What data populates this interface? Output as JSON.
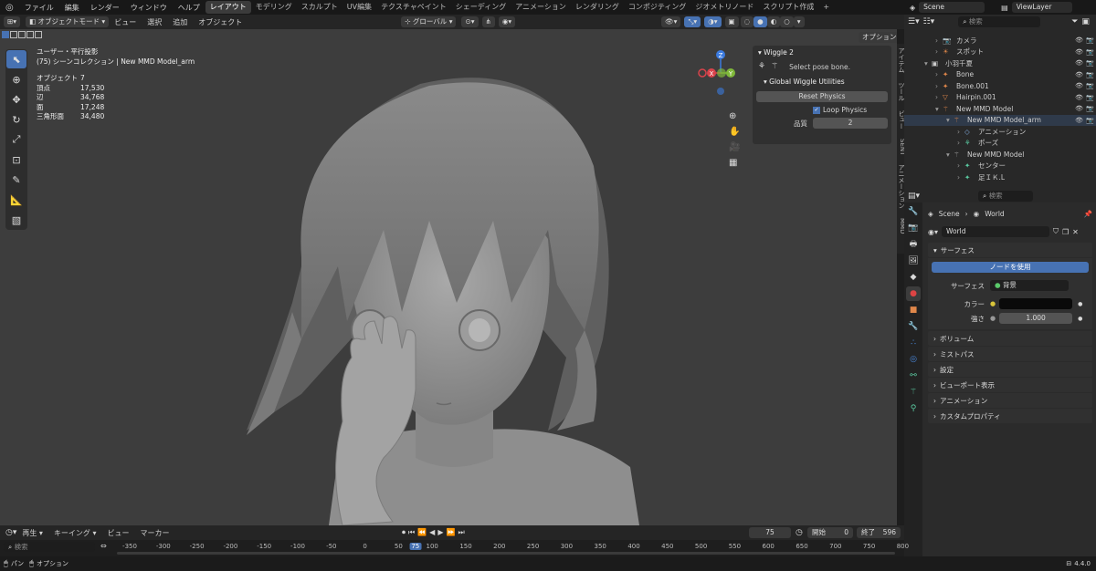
{
  "top_menu": [
    "ファイル",
    "編集",
    "レンダー",
    "ウィンドウ",
    "ヘルプ"
  ],
  "workspaces": [
    "レイアウト",
    "モデリング",
    "スカルプト",
    "UV編集",
    "テクスチャペイント",
    "シェーディング",
    "アニメーション",
    "レンダリング",
    "コンポジティング",
    "ジオメトリノード",
    "スクリプト作成"
  ],
  "active_workspace": "レイアウト",
  "add_tab": "+",
  "scene_name": "Scene",
  "view_layer": "ViewLayer",
  "viewport_header": {
    "mode": "オブジェクトモード",
    "menus": [
      "ビュー",
      "選択",
      "追加",
      "オブジェクト"
    ],
    "transform": "グローバル",
    "options": "オプション"
  },
  "viewport_info": {
    "view": "ユーザー・平行投影",
    "collection": "(75) シーンコレクション | New MMD Model_arm",
    "stats": [
      {
        "label": "オブジェクト",
        "value": "7"
      },
      {
        "label": "頂点",
        "value": "17,530"
      },
      {
        "label": "辺",
        "value": "34,768"
      },
      {
        "label": "面",
        "value": "17,248"
      },
      {
        "label": "三角形面",
        "value": "34,480"
      }
    ]
  },
  "gizmo": {
    "z": "Z",
    "y": "Y",
    "x": "X"
  },
  "side_tabs": [
    "アイテム",
    "ツール",
    "ビュー",
    "SENT",
    "アニメーション",
    "MMD"
  ],
  "wiggle_panel": {
    "title": "Wiggle 2",
    "hint": "Select pose bone.",
    "utilities": "Global Wiggle Utilities",
    "reset": "Reset Physics",
    "loop": "Loop Physics",
    "quality_label": "品質",
    "quality_value": "2"
  },
  "outliner": {
    "search_placeholder": "検索",
    "rows": [
      {
        "label": "カメラ",
        "indent": 1,
        "icon": "camera-icon",
        "color": "#e0874a"
      },
      {
        "label": "スポット",
        "indent": 1,
        "icon": "light-icon",
        "color": "#e0874a"
      },
      {
        "label": "小羽千夏",
        "indent": 0,
        "icon": "collection-icon",
        "color": "#ccc"
      },
      {
        "label": "Bone",
        "indent": 1,
        "icon": "bone-icon",
        "color": "#e0874a"
      },
      {
        "label": "Bone.001",
        "indent": 1,
        "icon": "bone-icon",
        "color": "#e0874a"
      },
      {
        "label": "Hairpin.001",
        "indent": 1,
        "icon": "mesh-icon",
        "color": "#e0874a"
      },
      {
        "label": "New MMD Model",
        "indent": 1,
        "icon": "armature-icon",
        "color": "#e0874a"
      },
      {
        "label": "New MMD Model_arm",
        "indent": 2,
        "icon": "armature-icon",
        "color": "#e0874a"
      },
      {
        "label": "アニメーション",
        "indent": 3,
        "icon": "anim-icon",
        "color": "#7fa8d8"
      },
      {
        "label": "ポーズ",
        "indent": 3,
        "icon": "pose-icon",
        "color": "#5ac9a0"
      },
      {
        "label": "New MMD Model",
        "indent": 2,
        "icon": "armature-icon",
        "color": "#aaa"
      },
      {
        "label": "センター",
        "indent": 3,
        "icon": "bone-icon",
        "color": "#5ac9a0"
      },
      {
        "label": "足ＩＫ.L",
        "indent": 3,
        "icon": "bone-icon",
        "color": "#5ac9a0"
      }
    ]
  },
  "properties": {
    "search_placeholder": "検索",
    "breadcrumb_scene": "Scene",
    "breadcrumb_world": "World",
    "world_name": "World",
    "surface_section": "サーフェス",
    "use_nodes": "ノードを使用",
    "surface_label": "サーフェス",
    "surface_value": "背景",
    "color_label": "カラー",
    "strength_label": "強さ",
    "strength_value": "1.000",
    "sections": [
      "ボリューム",
      "ミストパス",
      "設定",
      "ビューポート表示",
      "アニメーション",
      "カスタムプロパティ"
    ]
  },
  "timeline": {
    "menus": [
      "再生",
      "キーイング",
      "ビュー",
      "マーカー"
    ],
    "current_frame": "75",
    "start_label": "開始",
    "start": "0",
    "end_label": "終了",
    "end": "596",
    "search_placeholder": "検索",
    "ticks": [
      "-350",
      "-300",
      "-250",
      "-200",
      "-150",
      "-100",
      "-50",
      "0",
      "50",
      "75",
      "100",
      "150",
      "200",
      "250",
      "300",
      "350",
      "400",
      "450",
      "500",
      "550",
      "600",
      "650",
      "700",
      "750",
      "800"
    ]
  },
  "status_bar": {
    "left1": "パン",
    "left2": "オプション",
    "version": "4.4.0"
  }
}
